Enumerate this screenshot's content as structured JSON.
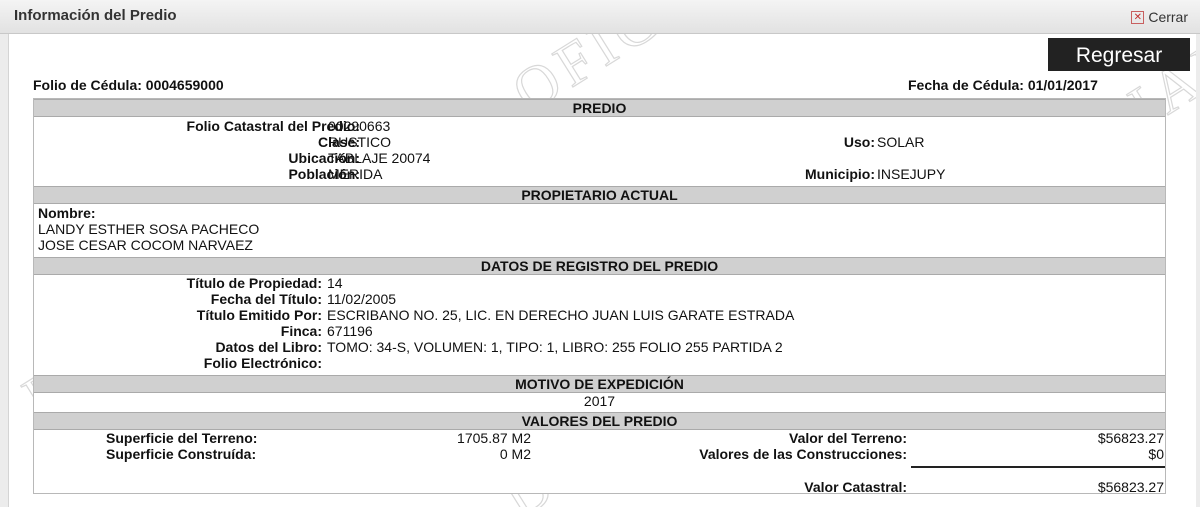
{
  "window": {
    "title": "Información del Predio",
    "close_label": "Cerrar"
  },
  "actions": {
    "back_label": "Regresar"
  },
  "header": {
    "folio_label": "Folio de Cédula:",
    "folio_value": "0004659000",
    "fecha_label": "Fecha de Cédula:",
    "fecha_value": "01/01/2017"
  },
  "predio": {
    "title": "PREDIO",
    "folio_catastral_label": "Folio Catastral del Predio:",
    "folio_catastral": "00290663",
    "clase_label": "Clase:",
    "clase": "RUSTICO",
    "ubicacion_label": "Ubicación:",
    "ubicacion": "TABLAJE 20074",
    "poblacion_label": "Población:",
    "poblacion": "MERIDA",
    "uso_label": "Uso:",
    "uso": "SOLAR",
    "municipio_label": "Municipio:",
    "municipio": "INSEJUPY"
  },
  "propietario": {
    "title": "PROPIETARIO ACTUAL",
    "nombre_label": "Nombre:",
    "nombres": [
      "LANDY ESTHER SOSA PACHECO",
      "JOSE CESAR COCOM NARVAEZ"
    ]
  },
  "registro": {
    "title": "DATOS DE REGISTRO DEL PREDIO",
    "titulo_label": "Título de Propiedad:",
    "titulo": "14",
    "fecha_titulo_label": "Fecha del Título:",
    "fecha_titulo": "11/02/2005",
    "emitido_label": "Título Emitido Por:",
    "emitido": "ESCRIBANO NO. 25, LIC. EN DERECHO JUAN LUIS GARATE ESTRADA",
    "finca_label": "Finca:",
    "finca": "671196",
    "libro_label": "Datos del Libro:",
    "libro": "TOMO: 34-S, VOLUMEN: 1, TIPO: 1, LIBRO: 255 FOLIO 255 PARTIDA 2",
    "folio_electronico_label": "Folio Electrónico:",
    "folio_electronico": ""
  },
  "motivo": {
    "title": "MOTIVO DE EXPEDICIÓN",
    "value": "2017"
  },
  "valores": {
    "title": "VALORES DEL PREDIO",
    "sup_terreno_label": "Superficie del Terreno:",
    "sup_terreno": "1705.87 M2",
    "sup_construida_label": "Superficie Construída:",
    "sup_construida": "0 M2",
    "valor_terreno_label": "Valor del Terreno:",
    "valor_terreno": "$56823.27",
    "valor_construcciones_label": "Valores de las Construcciones:",
    "valor_construcciones": "$0",
    "valor_catastral_label": "Valor Catastral:",
    "valor_catastral": "$56823.27"
  },
  "watermark": {
    "text": "DOCUMENTO NO OFICIAL",
    "color": "#e0e0e0"
  }
}
